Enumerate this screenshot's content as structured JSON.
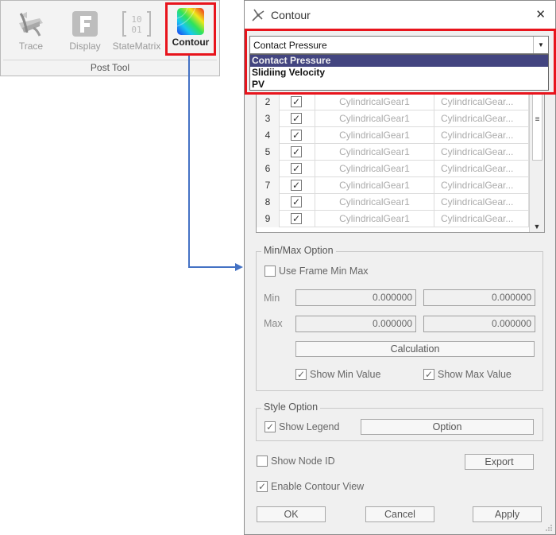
{
  "ribbon": {
    "buttons": [
      {
        "label": "Trace",
        "icon": "trace-icon"
      },
      {
        "label": "Display",
        "icon": "display-icon"
      },
      {
        "label": "StateMatrix",
        "icon": "state-matrix-icon",
        "icon_text_top": "10",
        "icon_text_bottom": "01"
      },
      {
        "label": "Contour",
        "icon": "contour-icon"
      }
    ],
    "group_label": "Post Tool"
  },
  "dialog": {
    "title": "Contour",
    "close_glyph": "✕",
    "result_type": {
      "value": "Contact Pressure",
      "options": [
        "Contact Pressure",
        "Slidiing Velocity",
        "PV"
      ],
      "selected_index": 0
    },
    "table": {
      "rows": [
        {
          "num": "2",
          "checked": true,
          "body1": "CylindricalGear1",
          "body2": "CylindricalGear..."
        },
        {
          "num": "3",
          "checked": true,
          "body1": "CylindricalGear1",
          "body2": "CylindricalGear..."
        },
        {
          "num": "4",
          "checked": true,
          "body1": "CylindricalGear1",
          "body2": "CylindricalGear..."
        },
        {
          "num": "5",
          "checked": true,
          "body1": "CylindricalGear1",
          "body2": "CylindricalGear..."
        },
        {
          "num": "6",
          "checked": true,
          "body1": "CylindricalGear1",
          "body2": "CylindricalGear..."
        },
        {
          "num": "7",
          "checked": true,
          "body1": "CylindricalGear1",
          "body2": "CylindricalGear..."
        },
        {
          "num": "8",
          "checked": true,
          "body1": "CylindricalGear1",
          "body2": "CylindricalGear..."
        },
        {
          "num": "9",
          "checked": true,
          "body1": "CylindricalGear1",
          "body2": "CylindricalGear..."
        }
      ]
    },
    "minmax": {
      "title": "Min/Max Option",
      "use_frame_label": "Use Frame Min Max",
      "use_frame_checked": false,
      "min_label": "Min",
      "max_label": "Max",
      "min_value_1": "0.000000",
      "min_value_2": "0.000000",
      "max_value_1": "0.000000",
      "max_value_2": "0.000000",
      "calculation_label": "Calculation",
      "show_min_label": "Show Min Value",
      "show_min_checked": true,
      "show_max_label": "Show Max Value",
      "show_max_checked": true
    },
    "style": {
      "title": "Style Option",
      "show_legend_label": "Show Legend",
      "show_legend_checked": true,
      "option_label": "Option"
    },
    "show_node_id_label": "Show Node ID",
    "show_node_id_checked": false,
    "export_label": "Export",
    "enable_contour_label": "Enable Contour View",
    "enable_contour_checked": true,
    "ok_label": "OK",
    "cancel_label": "Cancel",
    "apply_label": "Apply"
  },
  "colors": {
    "highlight": "#e8141c",
    "connector": "#4472c4",
    "selection": "#434580"
  },
  "check_glyph": "✓",
  "combo_arrow_glyph": "▼"
}
